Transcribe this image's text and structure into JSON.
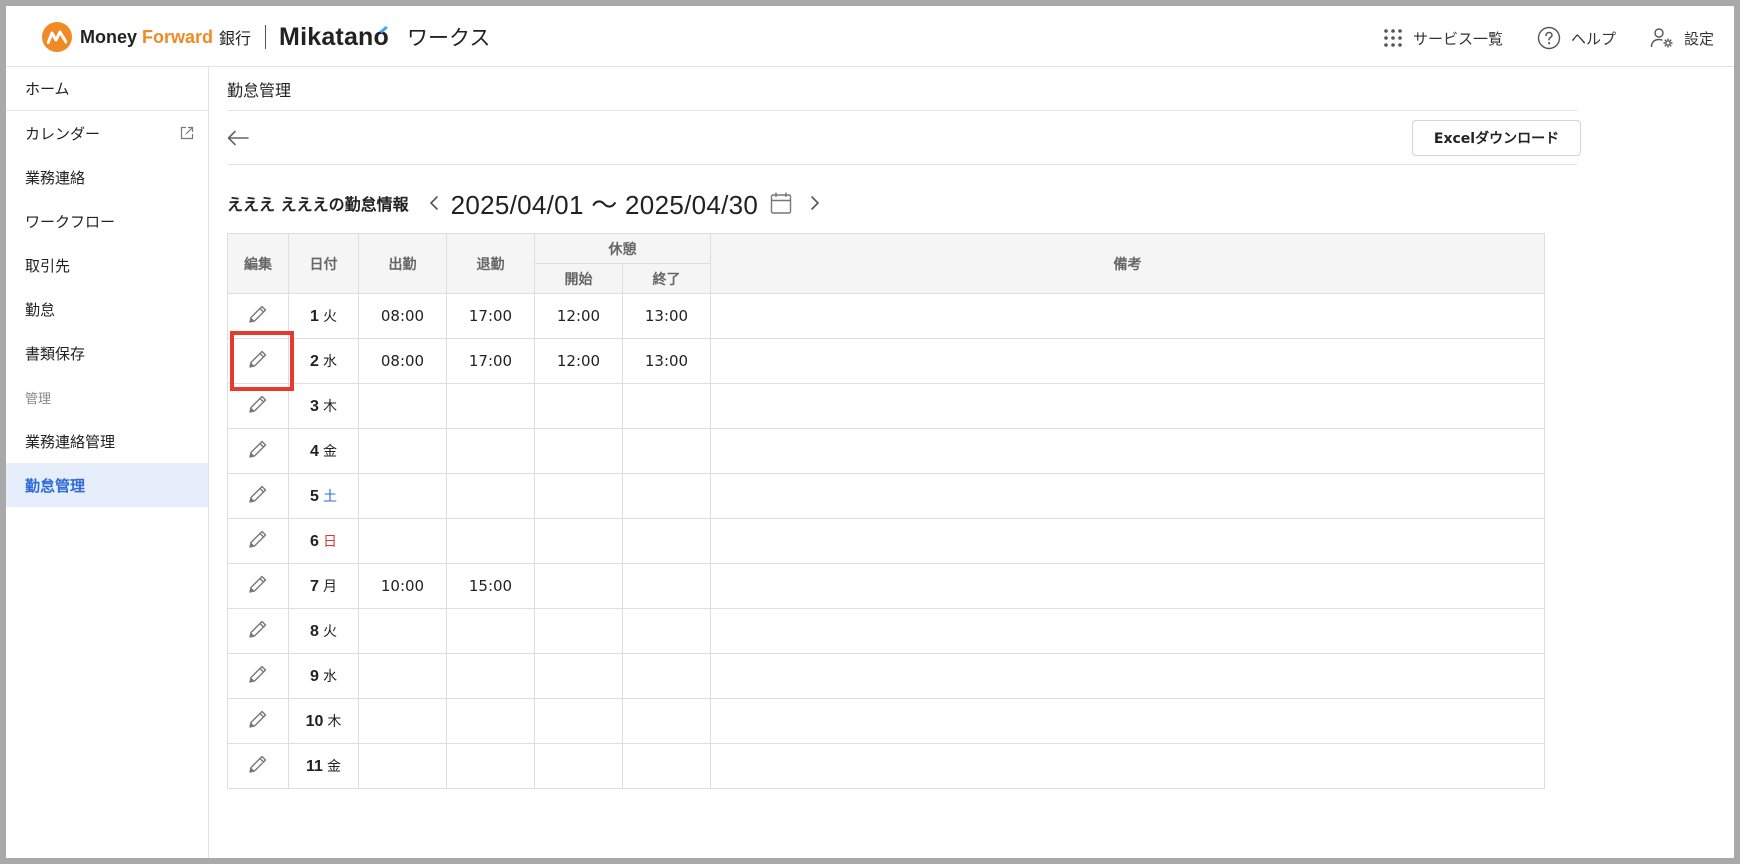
{
  "header": {
    "logo": {
      "money": "Money",
      "forward": "Forward",
      "bank": "銀行",
      "product": "Mikatano",
      "product_suffix": "ワークス"
    },
    "actions": [
      {
        "label": "サービス一覧",
        "icon": "grid-icon"
      },
      {
        "label": "ヘルプ",
        "icon": "help-icon"
      },
      {
        "label": "設定",
        "icon": "user-settings-icon"
      }
    ]
  },
  "sidebar": {
    "items": [
      {
        "label": "ホーム"
      },
      {
        "label": "カレンダー",
        "icon": "external-link-icon"
      },
      {
        "label": "業務連絡"
      },
      {
        "label": "ワークフロー"
      },
      {
        "label": "取引先"
      },
      {
        "label": "勤怠"
      },
      {
        "label": "書類保存"
      }
    ],
    "section_label": "管理",
    "admin_items": [
      {
        "label": "業務連絡管理"
      },
      {
        "label": "勤怠管理",
        "active": true
      }
    ]
  },
  "main": {
    "breadcrumb": "勤怠管理",
    "excel_button": "Excelダウンロード",
    "employee_title": "えええ えええの勤怠情報",
    "period": "2025/04/01 〜 2025/04/30"
  },
  "table": {
    "headers": {
      "edit": "編集",
      "date": "日付",
      "clock_in": "出勤",
      "clock_out": "退勤",
      "break": "休憩",
      "break_start": "開始",
      "break_end": "終了",
      "note": "備考"
    },
    "rows": [
      {
        "day": "1",
        "dow": "火",
        "in": "08:00",
        "out": "17:00",
        "bstart": "12:00",
        "bend": "13:00",
        "note": ""
      },
      {
        "day": "2",
        "dow": "水",
        "in": "08:00",
        "out": "17:00",
        "bstart": "12:00",
        "bend": "13:00",
        "note": ""
      },
      {
        "day": "3",
        "dow": "木",
        "in": "",
        "out": "",
        "bstart": "",
        "bend": "",
        "note": ""
      },
      {
        "day": "4",
        "dow": "金",
        "in": "",
        "out": "",
        "bstart": "",
        "bend": "",
        "note": ""
      },
      {
        "day": "5",
        "dow": "土",
        "in": "",
        "out": "",
        "bstart": "",
        "bend": "",
        "note": ""
      },
      {
        "day": "6",
        "dow": "日",
        "in": "",
        "out": "",
        "bstart": "",
        "bend": "",
        "note": ""
      },
      {
        "day": "7",
        "dow": "月",
        "in": "10:00",
        "out": "15:00",
        "bstart": "",
        "bend": "",
        "note": ""
      },
      {
        "day": "8",
        "dow": "火",
        "in": "",
        "out": "",
        "bstart": "",
        "bend": "",
        "note": ""
      },
      {
        "day": "9",
        "dow": "水",
        "in": "",
        "out": "",
        "bstart": "",
        "bend": "",
        "note": ""
      },
      {
        "day": "10",
        "dow": "木",
        "in": "",
        "out": "",
        "bstart": "",
        "bend": "",
        "note": ""
      },
      {
        "day": "11",
        "dow": "金",
        "in": "",
        "out": "",
        "bstart": "",
        "bend": "",
        "note": ""
      }
    ]
  },
  "colors": {
    "brand_orange": "#f08a24",
    "accent_blue": "#2f6bd8",
    "sunday_red": "#d83a3a",
    "highlight_red": "#e8392f"
  }
}
